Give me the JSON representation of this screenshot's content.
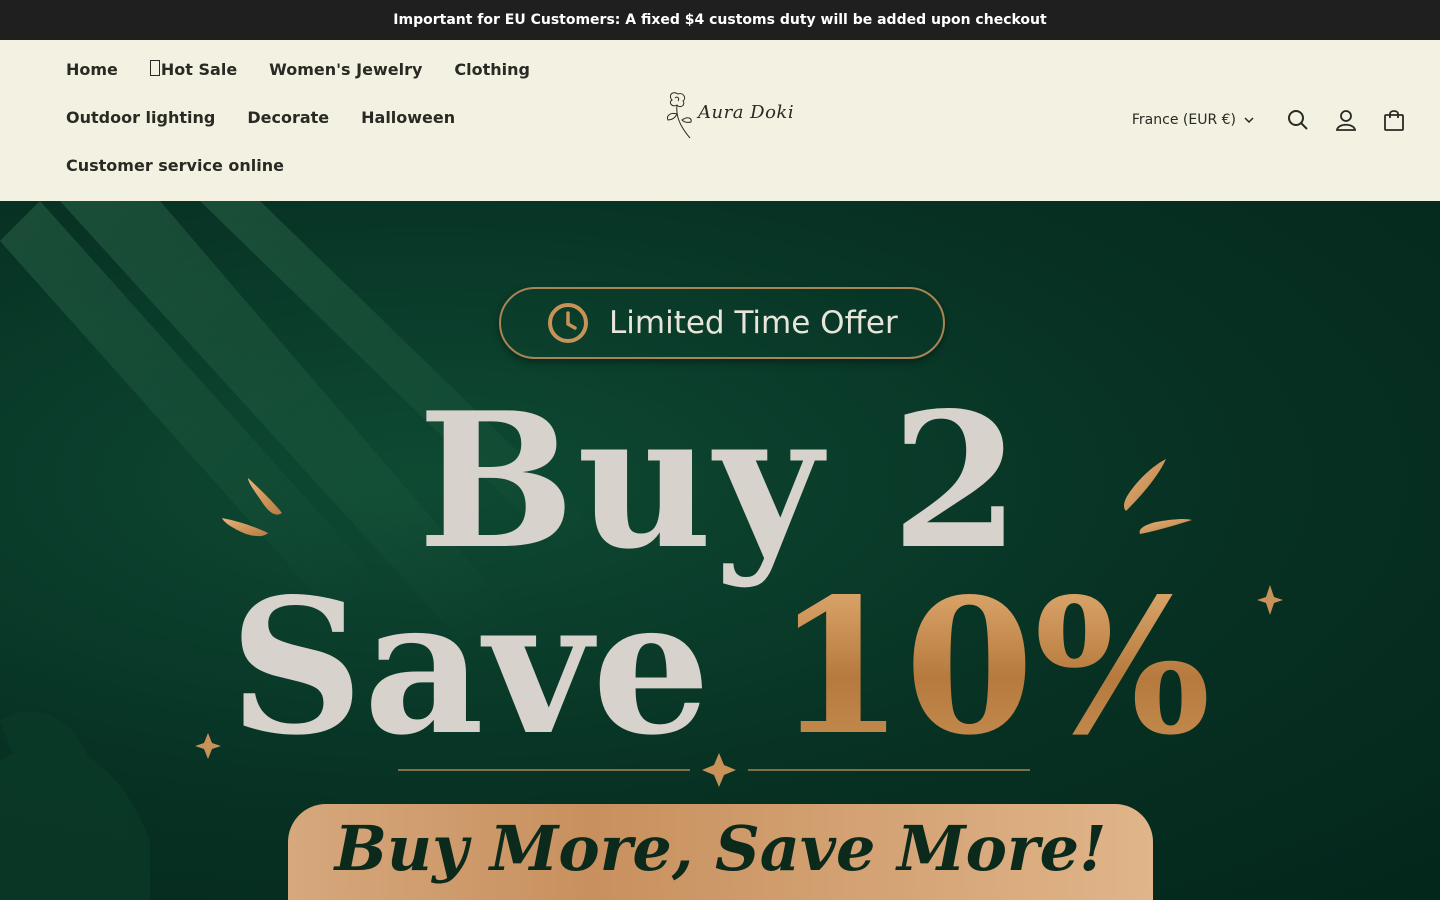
{
  "announcement": {
    "text": "Important for EU Customers: A fixed $4 customs duty will be added upon checkout"
  },
  "nav": {
    "items": [
      {
        "label": "Home"
      },
      {
        "label": "Hot Sale"
      },
      {
        "label": "Women's Jewelry"
      },
      {
        "label": "Clothing"
      },
      {
        "label": "Outdoor lighting"
      },
      {
        "label": "Decorate"
      },
      {
        "label": "Halloween"
      },
      {
        "label": "Customer service online"
      }
    ]
  },
  "logo": {
    "text": "Aura Doki"
  },
  "header_tools": {
    "country_selector": "France (EUR €)",
    "search_icon": "search-icon",
    "account_icon": "account-icon",
    "cart_icon": "cart-icon"
  },
  "hero": {
    "badge": "Limited Time Offer",
    "headline_line1": "Buy 2",
    "headline_line2_a": "Save",
    "headline_line2_b": "10%",
    "cta": "Buy More, Save More!"
  },
  "colors": {
    "announcement_bg": "#1f1f1f",
    "header_bg": "#f3f1e1",
    "hero_bg": "#073123",
    "gold_accent": "#c8905e",
    "headline_text": "#d7d2cb"
  }
}
